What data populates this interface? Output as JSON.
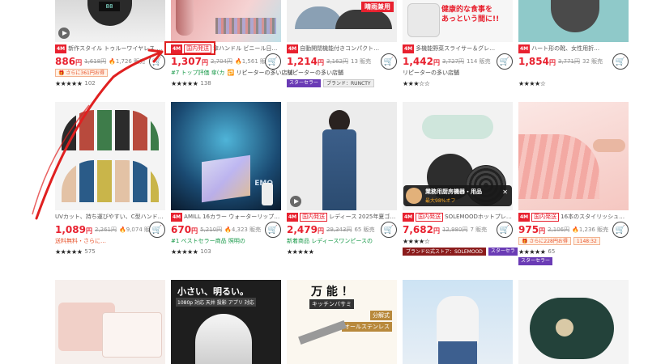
{
  "colors": {
    "accent": "#e8212f",
    "green": "#1a9a4a",
    "star_badge": "#6a3bb5",
    "annotation_red": "#e02020"
  },
  "products": [
    {
      "tag_sale": "4M\nセール",
      "tag_domestic": "",
      "title": "新作スタイル トゥルーワイヤレス オンイヤー…",
      "price": "886",
      "yen": "円",
      "old_price": "1,618円",
      "sold": "🔥1,726 販売",
      "sub1": "🎁 さらに361円お得",
      "stars": "★★★★★",
      "reviews": "102"
    },
    {
      "tag_sale": "4M\nセール",
      "tag_domestic": "国内発送",
      "title": "傘ハンドル ビニール日よけ…",
      "price": "1,307",
      "yen": "円",
      "old_price": "2,704円",
      "sold": "🔥1,561 販売",
      "sub1": "#7 トップ評価 傘(カ",
      "stars": "★★★★★",
      "reviews": "138"
    },
    {
      "tag_sale": "4M\nセール",
      "tag_domestic": "",
      "title": "自動開閉機能付きコンパクト…",
      "price": "1,214",
      "yen": "円",
      "old_price": "3,162円",
      "sold": "13 販売",
      "sub1": "リピーターの多い店舗",
      "badge_star": "スターセラー",
      "badge_brand": "ブランド：RUNCTY"
    },
    {
      "tag_sale": "4M\nセール",
      "tag_domestic": "",
      "title": "多機能野菜スライサー＆グレ…",
      "price": "1,442",
      "yen": "円",
      "old_price": "3,727円",
      "sold": "114 販売",
      "sub1": "リピーターの多い店舗",
      "stars": "★★★☆☆",
      "reviews": ""
    },
    {
      "tag_sale": "4M\nセール",
      "tag_domestic": "",
      "title": "ハート形の靴、女性用折…",
      "price": "1,854",
      "yen": "円",
      "old_price": "3,771円",
      "sold": "32 販売",
      "stars": "★★★★☆",
      "reviews": ""
    },
    {
      "tag_sale": "",
      "tag_domestic": "",
      "title": "UVカット、持ち運びやすい、C型ハンドル傘、2段…",
      "price": "1,089",
      "yen": "円",
      "old_price": "2,261円",
      "sold": "🔥9,074 販売",
      "sub1": "送料無料・さらに…",
      "stars": "★★★★★",
      "reviews": "575"
    },
    {
      "tag_sale": "4M\nセール",
      "tag_domestic": "",
      "title": "AMILL 16カラー ウォーターリップル USBライ…",
      "price": "670",
      "yen": "円",
      "old_price": "5,210円",
      "sold": "🔥4,323 販売",
      "sub1": "#1 ベストセラー商品 照明の",
      "stars": "★★★★★",
      "reviews": "103"
    },
    {
      "tag_sale": "4M\nセール",
      "tag_domestic": "国内発送",
      "title": "レディース 2025年夏ゴムドレ…",
      "price": "2,479",
      "yen": "円",
      "old_price": "29,343円",
      "sold": "65 販売",
      "sub1": "新着商品 レディースワンピースの",
      "stars": "★★★★★",
      "reviews": ""
    },
    {
      "tag_sale": "4M\nセール",
      "tag_domestic": "国内発送",
      "title": "SOLEMOODホットプレート…",
      "price": "7,682",
      "yen": "円",
      "old_price": "12,980円",
      "sold": "7 販売",
      "sub1": "",
      "stars": "★★★★☆",
      "reviews": "",
      "badge_brand": "ブランド公式ストア：SOLEMOOD",
      "badge_star": "スターセラ"
    },
    {
      "tag_sale": "4M\nセール",
      "tag_domestic": "国内発送",
      "title": "16本のスタイリッシュな手動傘、歯がったれ…",
      "price": "975",
      "yen": "円",
      "old_price": "2,106円",
      "sold": "🔥1,236 販売",
      "sub1": "🎁 さらに228円お得",
      "coupon": "1148:32",
      "stars": "★★★★★",
      "reviews": "65",
      "badge_star": "スターセラー"
    }
  ],
  "overlays": {
    "row1_card4_badge": "晴雨兼用",
    "row1_card4_ad": "健康的な食事を\nあっという間に!!",
    "row2_card2_label": "EMO",
    "popup_title": "業務用厨房機器・用品",
    "popup_sub": "最大98%オフ",
    "popup_close": "✕",
    "row3_card2_text": "小さい、明るい。",
    "row3_card2_specs": "1080p 対応  天井 投影  アプリ 対応",
    "row3_card3_title": "万 能 ！",
    "row3_card3_sub": "キッチンバサミ",
    "row3_card3_badge1": "分解式",
    "row3_card3_badge2": "オールステンレス"
  },
  "cart_icon": "cart-icon"
}
